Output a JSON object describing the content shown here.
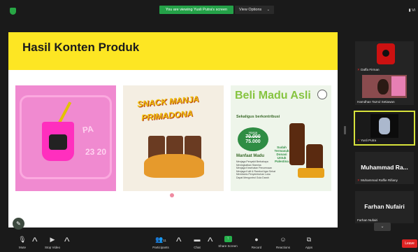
{
  "meeting": {
    "viewing_banner": "You are viewing Yusli Putra's screen",
    "view_options": "View Options",
    "view_button": "Vi"
  },
  "slide": {
    "title": "Hasil Konten Produk",
    "product1": {
      "text_a": "PA",
      "text_b": "23 20"
    },
    "product2": {
      "title_line1": "SNACK MANJA",
      "title_line2": "PRIMADONA"
    },
    "product3": {
      "headline": "Beli Madu Asli",
      "subline": "Sekaligus berkontribusi",
      "price_label": "Harga",
      "price_old": "70.000",
      "price_new": "75.000",
      "donation_note": "Sudah Termasuk Donasi Untuk Palestina",
      "benefits_title": "Manfaat Madu",
      "benefits": [
        "Menjaga Penyakit Berbahaya",
        "Meningkatkan Stamina",
        "Menjaga Kesehatan Pencernaan",
        "Menjaga Kulit & Rambut Agar Sehat",
        "Membantu Penyembuhan Luka",
        "Dapat Mengontrol Gula Darah"
      ]
    }
  },
  "participants": [
    {
      "name": "Daffa Firman",
      "muted": true
    },
    {
      "name": "Hamdhan Tazrul Setiawan",
      "muted": false
    },
    {
      "name": "Yusli Putra",
      "muted": true,
      "active_speaker": true
    },
    {
      "display": "Muhammad Ra...",
      "name": "Muhammad Raffie Rifiany",
      "muted": true
    },
    {
      "display": "Farhan Nufairi",
      "name": "Farhan Nufairi",
      "muted": false
    }
  ],
  "toolbar": {
    "mute": "Mute",
    "stop_video": "Stop Video",
    "participants": "Participants",
    "participants_count": "11",
    "chat": "Chat",
    "share_screen": "Share Screen",
    "record": "Record",
    "reactions": "Reactions",
    "apps": "Apps",
    "leave": "Leave"
  },
  "colors": {
    "share_green": "#24a148",
    "slide_header_yellow": "#fde623",
    "active_speaker_border": "#d7e23b",
    "leave_red": "#e02424"
  }
}
